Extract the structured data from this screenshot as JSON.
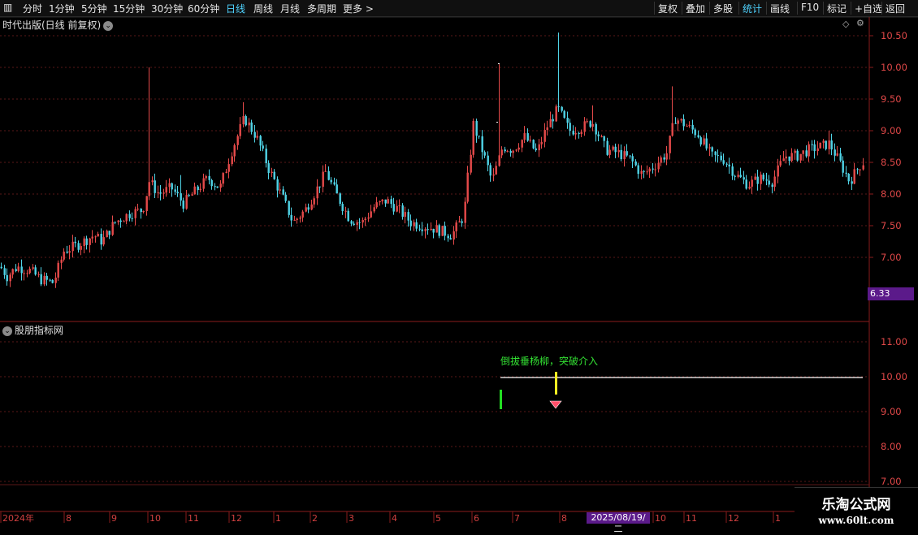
{
  "toolbar": {
    "left": [
      "分时",
      "1分钟",
      "5分钟",
      "15分钟",
      "30分钟",
      "60分钟",
      "日线",
      "周线",
      "月线",
      "多周期",
      "更多 >"
    ],
    "active": "日线",
    "right": [
      "复权",
      "叠加",
      "多股",
      "统计",
      "画线",
      "F10",
      "标记",
      "+自选",
      "返回"
    ],
    "right_active": "统计"
  },
  "main_pane": {
    "title": "时代出版(日线 前复权)",
    "price_tag": "6.33",
    "axis_ticks": [
      "10.50",
      "10.00",
      "9.50",
      "9.00",
      "8.50",
      "8.00",
      "7.50",
      "7.00"
    ],
    "colors": {
      "up": "#e64a4a",
      "down": "#4fd3e6",
      "grid": "#5a1818"
    }
  },
  "indicator_pane": {
    "title": "股朋指标网",
    "signal_text": "倒拔垂杨柳，突破介入",
    "axis_ticks": [
      "11.00",
      "10.00",
      "9.00",
      "8.00",
      "7.00"
    ]
  },
  "date_axis": {
    "labels": [
      "2024年",
      "8",
      "9",
      "10",
      "11",
      "12",
      "1",
      "2",
      "3",
      "4",
      "5",
      "6",
      "7",
      "8",
      "10",
      "11",
      "12",
      "1"
    ],
    "cursor_date": "2025/08/19/二"
  },
  "watermark": {
    "title": "乐淘公式网",
    "url": "www.60lt.com"
  }
}
